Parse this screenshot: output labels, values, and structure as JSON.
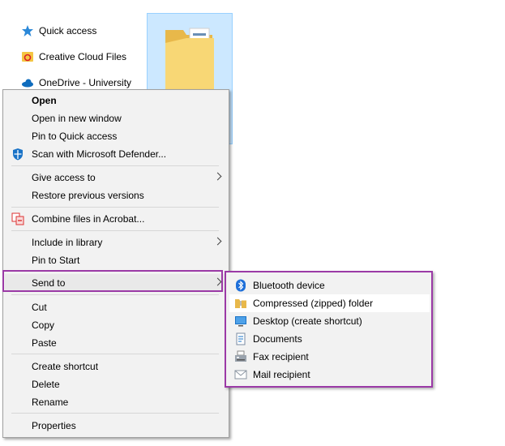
{
  "nav": {
    "items": [
      {
        "label": "Quick access",
        "icon": "star-icon"
      },
      {
        "label": "Creative Cloud Files",
        "icon": "creative-cloud-icon"
      },
      {
        "label": "OneDrive - University",
        "icon": "onedrive-icon"
      }
    ]
  },
  "context_menu": {
    "items": [
      {
        "label": "Open",
        "bold": true
      },
      {
        "label": "Open in new window"
      },
      {
        "label": "Pin to Quick access"
      },
      {
        "label": "Scan with Microsoft Defender...",
        "icon": "defender-icon"
      },
      {
        "label": "Give access to",
        "submenu": true
      },
      {
        "label": "Restore previous versions"
      },
      {
        "label": "Combine files in Acrobat...",
        "icon": "acrobat-icon"
      },
      {
        "label": "Include in library",
        "submenu": true
      },
      {
        "label": "Pin to Start"
      },
      {
        "label": "Send to",
        "submenu": true,
        "highlighted": true
      },
      {
        "label": "Cut"
      },
      {
        "label": "Copy"
      },
      {
        "label": "Paste"
      },
      {
        "label": "Create shortcut"
      },
      {
        "label": "Delete"
      },
      {
        "label": "Rename"
      },
      {
        "label": "Properties"
      }
    ]
  },
  "send_to_submenu": {
    "items": [
      {
        "label": "Bluetooth device",
        "icon": "bluetooth-icon"
      },
      {
        "label": "Compressed (zipped) folder",
        "icon": "zip-folder-icon",
        "hovered": true
      },
      {
        "label": "Desktop (create shortcut)",
        "icon": "desktop-icon"
      },
      {
        "label": "Documents",
        "icon": "documents-icon"
      },
      {
        "label": "Fax recipient",
        "icon": "fax-icon"
      },
      {
        "label": "Mail recipient",
        "icon": "mail-icon"
      }
    ]
  },
  "colors": {
    "highlight_border": "#9b3aa6",
    "menu_bg": "#f2f2f2",
    "selection_bg": "#cce8ff"
  }
}
